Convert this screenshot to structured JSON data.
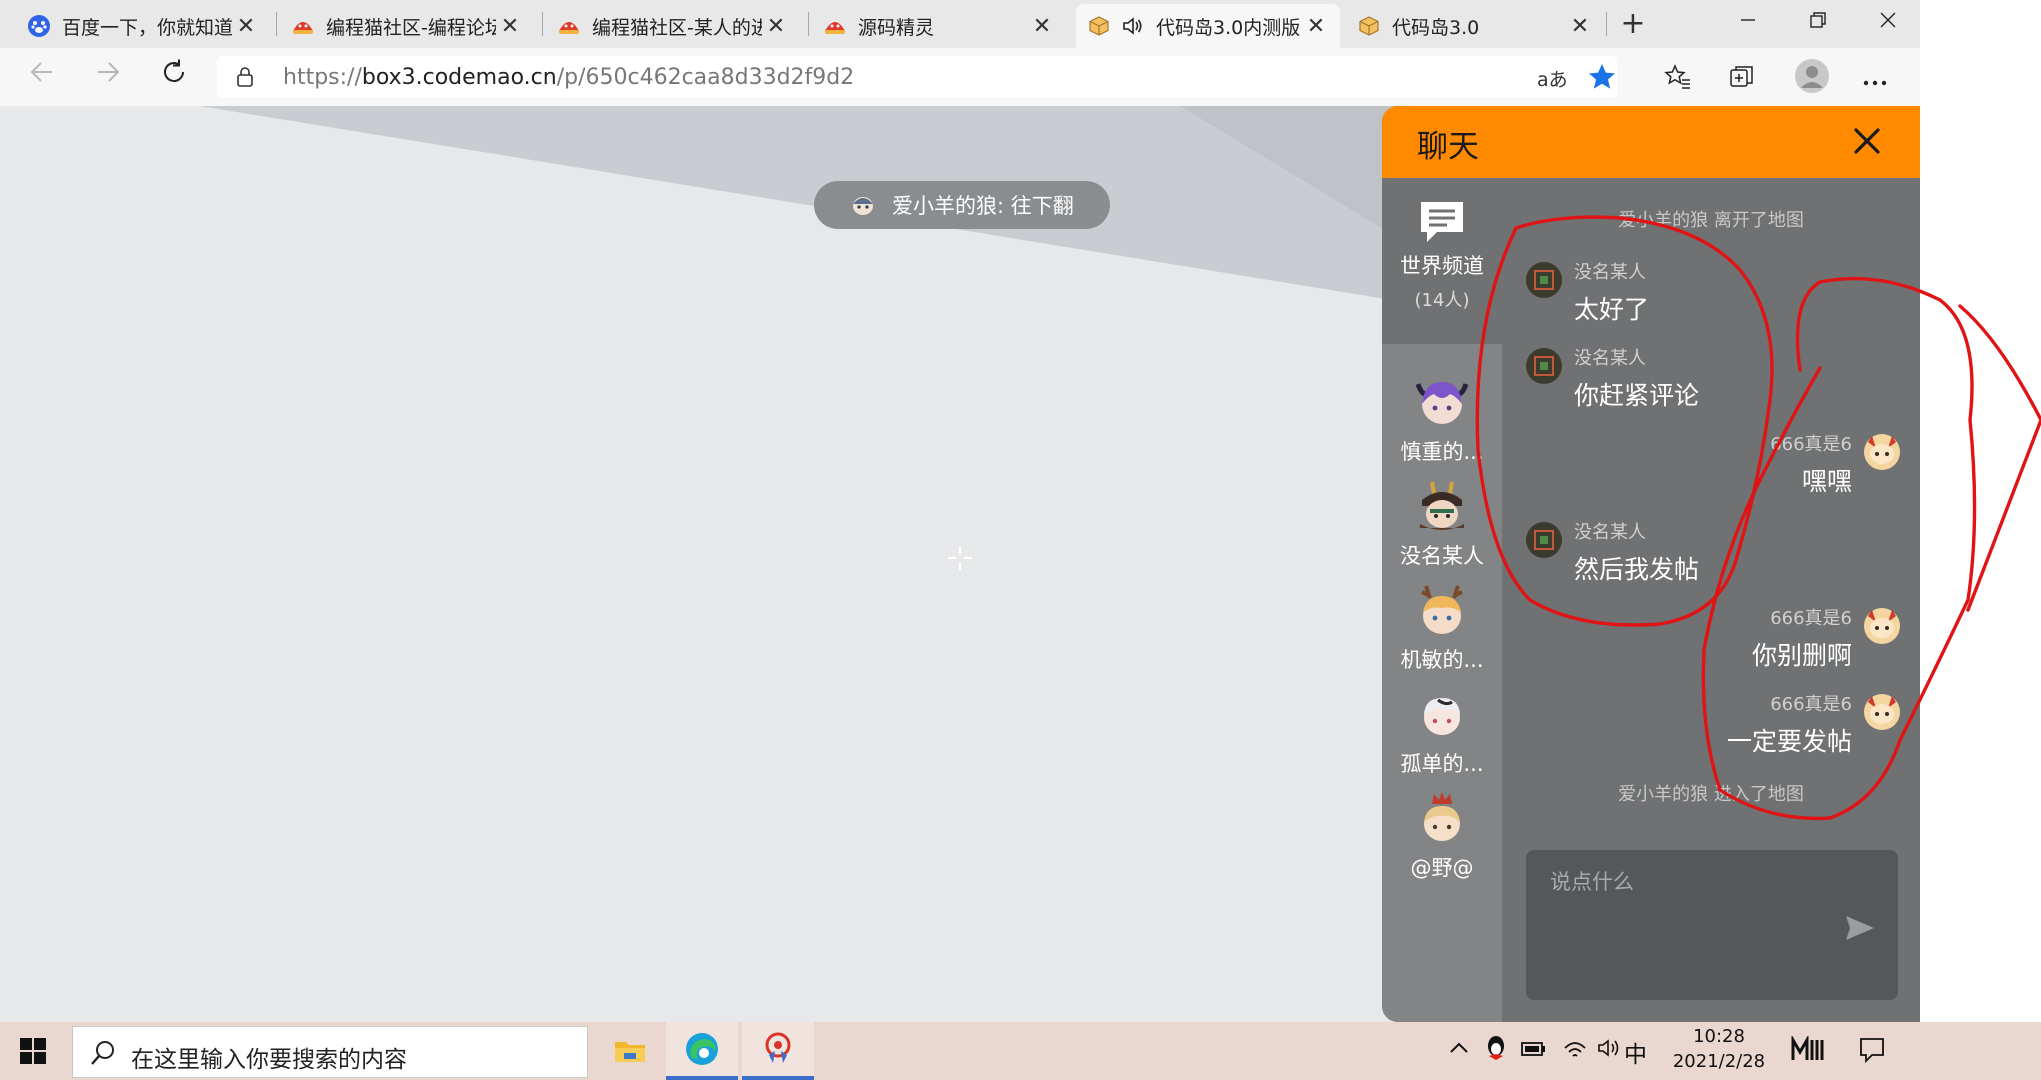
{
  "browser": {
    "tabs": [
      {
        "title": "百度一下，你就知道",
        "favicon": "baidu-paw-icon"
      },
      {
        "title": "编程猫社区-编程论坛",
        "favicon": "codemao-icon"
      },
      {
        "title": "编程猫社区-某人的进",
        "favicon": "codemao-icon"
      },
      {
        "title": "源码精灵",
        "favicon": "codemao-icon"
      },
      {
        "title": "代码岛3.0内测版",
        "favicon": "box3-cube-icon",
        "active": true
      },
      {
        "title": "代码岛3.0",
        "favicon": "box3-cube-icon"
      }
    ],
    "url_prefix": "https://",
    "url_host": "box3.codemao.cn",
    "url_path": "/p/650c462caa8d33d2f9d2",
    "read_aloud_label": "aあ"
  },
  "game": {
    "notice_chip": "爱小羊的狼: 往下翻"
  },
  "chat": {
    "title": "聊天",
    "channels": [
      {
        "label": "世界频道",
        "sub": "(14人)",
        "icon": "chat-bubble-icon"
      },
      {
        "label": "慎重的...",
        "icon": "avatar-purple-hair"
      },
      {
        "label": "没名某人",
        "icon": "avatar-samurai"
      },
      {
        "label": "机敏的...",
        "icon": "avatar-antlers"
      },
      {
        "label": "孤单的...",
        "icon": "avatar-white-hair"
      },
      {
        "label": "@野@",
        "icon": "avatar-crown"
      }
    ],
    "system_messages": [
      "爱小羊的狼 离开了地图",
      "爱小羊的狼 进入了地图"
    ],
    "messages": [
      {
        "user": "没名某人",
        "text": "太好了",
        "side": "left"
      },
      {
        "user": "没名某人",
        "text": "你赶紧评论",
        "side": "left"
      },
      {
        "user": "666真是6",
        "text": "嘿嘿",
        "side": "right"
      },
      {
        "user": "没名某人",
        "text": "然后我发帖",
        "side": "left"
      },
      {
        "user": "666真是6",
        "text": "你别删啊",
        "side": "right"
      },
      {
        "user": "666真是6",
        "text": "一定要发帖",
        "side": "right"
      }
    ],
    "input_placeholder": "说点什么"
  },
  "taskbar": {
    "search_placeholder": "在这里输入你要搜索的内容",
    "ime": "中",
    "time": "10:28",
    "date": "2021/2/28"
  },
  "colors": {
    "chat_header": "#ff8a00",
    "chat_body": "#6f7173",
    "annotation_red": "#e01414",
    "favorite_star": "#1a73e8"
  }
}
